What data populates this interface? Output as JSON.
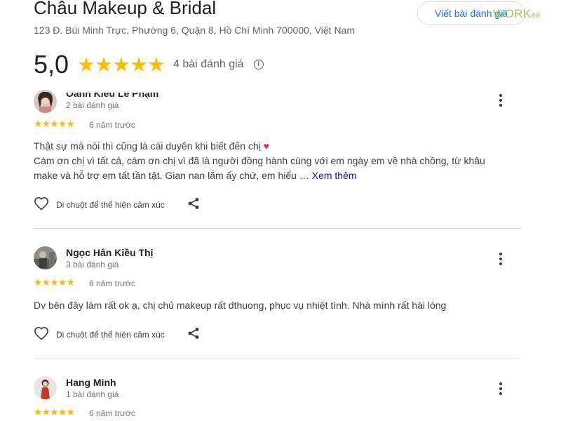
{
  "place": {
    "name": "Châu Makeup & Bridal",
    "address": "123 Đ. Bùi Minh Trực, Phường 6, Quận 8, Hồ Chí Minh 700000, Việt Nam",
    "write_review_label": "Viết bài đánh giá",
    "rating_value": "5,0",
    "rating_stars": "★★★★★",
    "review_count_label": "4 bài đánh giá",
    "star_color": "#fbbc04",
    "accent_color": "#1a73e8"
  },
  "watermark": {
    "main": "WORK",
    "suffix": "ee"
  },
  "reaction": {
    "hover_label": "Di chuột để thể hiện cảm xúc"
  },
  "reviews": [
    {
      "author": "Oanh Kiều Lê Phạm",
      "author_review_count": "2 bài đánh giá",
      "stars": "★★★★★",
      "time": "6 năm trước",
      "text_line1": "Thật sự mà nói thì cũng là cái duyên khi biết đến chị",
      "emoji": "♥",
      "text_rest": "Cám ơn chị vì tất cả, cám ơn chị vì đã là người đồng hành cùng với em ngày em về nhà chồng, từ khâu make và hỗ trợ em tất tần tật. Gian nan lắm ấy chứ, em hiểu …",
      "more_label": "Xem thêm"
    },
    {
      "author": "Ngọc Hân Kiều Thị",
      "author_review_count": "3 bài đánh giá",
      "stars": "★★★★★",
      "time": "6 năm trước",
      "text": "Dv bên đây làm rất ok ạ, chị chủ makeup rất dthuong, phục vụ nhiệt tình. Nhà mình rất hài lòng"
    },
    {
      "author": "Hang Minh",
      "author_review_count": "1 bài đánh giá",
      "stars": "★★★★★",
      "time": "6 năm trước"
    }
  ]
}
